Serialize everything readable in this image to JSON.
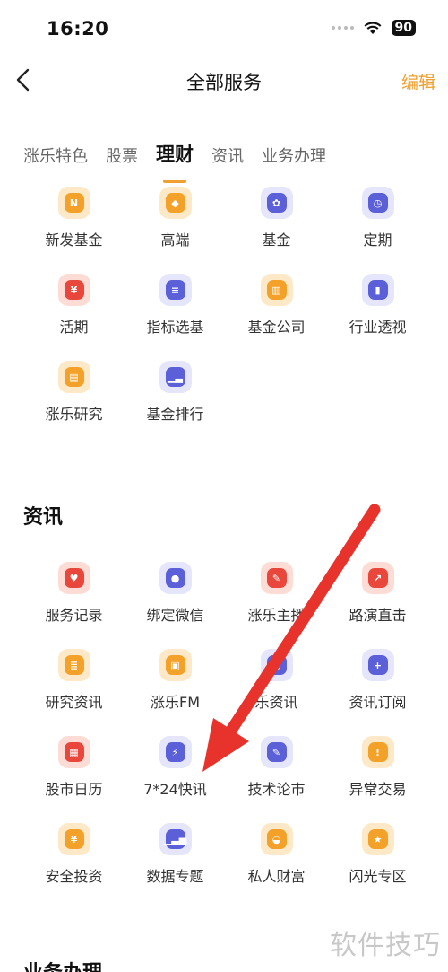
{
  "status_bar": {
    "time": "16:20",
    "battery": "90"
  },
  "nav": {
    "title": "全部服务",
    "edit_label": "编辑"
  },
  "tabs": [
    {
      "label": "涨乐特色"
    },
    {
      "label": "股票"
    },
    {
      "label": "理财"
    },
    {
      "label": "资讯"
    },
    {
      "label": "业务办理"
    }
  ],
  "wealth": {
    "items": [
      {
        "label": "新发基金",
        "icon": "new-fund-icon"
      },
      {
        "label": "高端",
        "icon": "diamond-icon"
      },
      {
        "label": "基金",
        "icon": "fund-icon"
      },
      {
        "label": "定期",
        "icon": "clock-icon"
      },
      {
        "label": "活期",
        "icon": "yuan-icon"
      },
      {
        "label": "指标选基",
        "icon": "slider-icon"
      },
      {
        "label": "基金公司",
        "icon": "building-icon"
      },
      {
        "label": "行业透视",
        "icon": "chart-icon"
      },
      {
        "label": "涨乐研究",
        "icon": "book-icon"
      },
      {
        "label": "基金排行",
        "icon": "ranking-icon"
      }
    ]
  },
  "news": {
    "title": "资讯",
    "items": [
      {
        "label": "服务记录",
        "icon": "heart-icon"
      },
      {
        "label": "绑定微信",
        "icon": "wechat-icon"
      },
      {
        "label": "涨乐主播",
        "icon": "broadcast-icon"
      },
      {
        "label": "路演直击",
        "icon": "roadshow-icon"
      },
      {
        "label": "研究资讯",
        "icon": "report-icon"
      },
      {
        "label": "涨乐FM",
        "icon": "radio-icon"
      },
      {
        "label": "乐资讯",
        "icon": "news-icon"
      },
      {
        "label": "资讯订阅",
        "icon": "subscribe-icon"
      },
      {
        "label": "股市日历",
        "icon": "calendar-icon"
      },
      {
        "label": "7*24快讯",
        "icon": "flash-icon"
      },
      {
        "label": "技术论市",
        "icon": "pen-icon"
      },
      {
        "label": "异常交易",
        "icon": "alert-icon"
      },
      {
        "label": "安全投资",
        "icon": "shield-icon"
      },
      {
        "label": "数据专题",
        "icon": "data-icon"
      },
      {
        "label": "私人财富",
        "icon": "wealth-icon"
      },
      {
        "label": "闪光专区",
        "icon": "star-icon"
      }
    ]
  },
  "business": {
    "title": "业务办理"
  },
  "watermark": "软件技巧",
  "colors": {
    "accent": "#f0a030",
    "arrow": "#e8322c"
  }
}
